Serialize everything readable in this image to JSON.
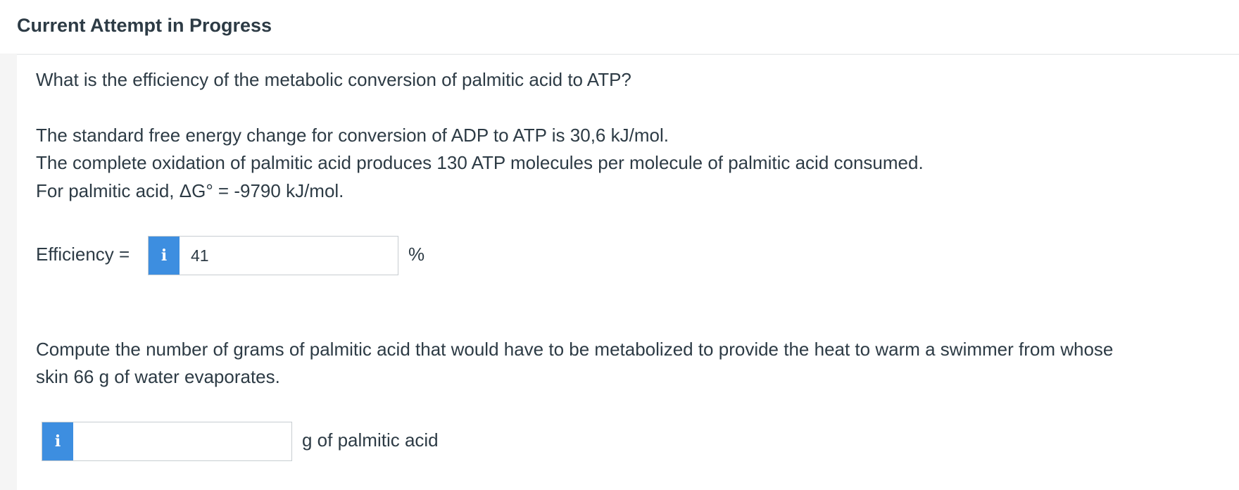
{
  "header": {
    "title": "Current Attempt in Progress"
  },
  "question": {
    "prompt": "What is the efficiency of the metabolic conversion of palmitic acid to ATP?",
    "facts": [
      "The standard free energy change for conversion of ADP to ATP is 30,6 kJ/mol.",
      "The complete oxidation of palmitic acid produces 130 ATP molecules per molecule of palmitic acid consumed.",
      "For palmitic acid, ΔG° = -9790 kJ/mol."
    ]
  },
  "efficiency": {
    "label": "Efficiency =",
    "info_glyph": "i",
    "value": "41",
    "unit": "%"
  },
  "question2": {
    "line1": "Compute the number of grams of palmitic acid that would have to be metabolized to provide the heat to warm a swimmer from whose",
    "line2": "skin 66 g of water evaporates."
  },
  "grams": {
    "info_glyph": "i",
    "value": "",
    "unit": "g of palmitic acid"
  },
  "colors": {
    "info_tab": "#3d8ee0",
    "text": "#2d3b45",
    "border": "#c7cdd1"
  }
}
